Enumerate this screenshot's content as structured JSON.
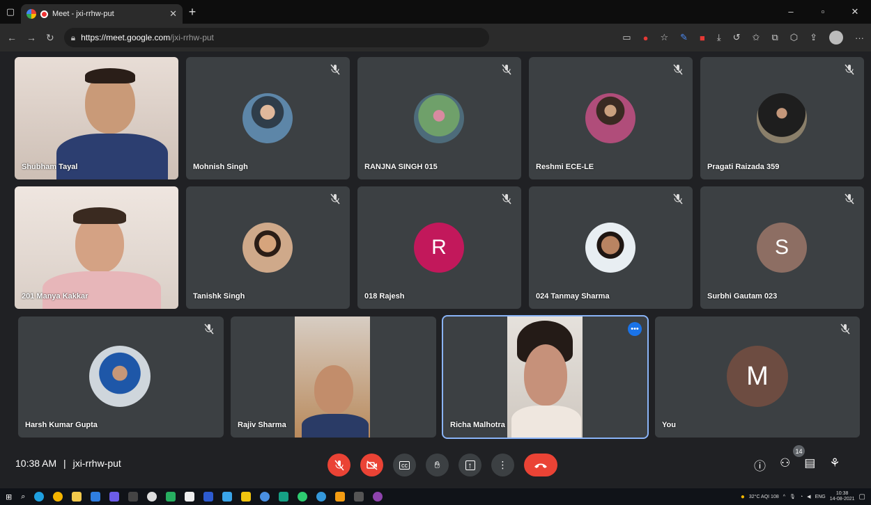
{
  "browser": {
    "tab_title": "Meet - jxi-rrhw-put",
    "url_host": "https://meet.google.com",
    "url_path": "/jxi-rrhw-put"
  },
  "tiles": [
    {
      "name": "Shubham Tayal"
    },
    {
      "name": "Mohnish Singh"
    },
    {
      "name": "RANJNA SINGH 015"
    },
    {
      "name": "Reshmi ECE-LE"
    },
    {
      "name": "Pragati Raizada 359"
    },
    {
      "name": "201 Manya Kakkar"
    },
    {
      "name": "Tanishk Singh"
    },
    {
      "name": "018 Rajesh",
      "initial": "R",
      "color": "#c2185b"
    },
    {
      "name": "024 Tanmay Sharma"
    },
    {
      "name": "Surbhi Gautam 023",
      "initial": "S",
      "color": "#8d6e63"
    },
    {
      "name": "Harsh Kumar Gupta"
    },
    {
      "name": "Rajiv Sharma"
    },
    {
      "name": "Richa Malhotra"
    },
    {
      "name": "You",
      "initial": "M",
      "color": "#6d4c41"
    }
  ],
  "meeting": {
    "time": "10:38 AM",
    "separator": "|",
    "code": "jxi-rrhw-put",
    "participant_count": "14"
  },
  "taskbar": {
    "weather": "32°C AQI 108",
    "lang": "ENG",
    "clock_time": "10:38",
    "clock_date": "14-08-2021"
  },
  "colors": {
    "accent_red": "#ea4335",
    "tile_bg": "#3c4043",
    "active_outline": "#8ab4f8"
  }
}
